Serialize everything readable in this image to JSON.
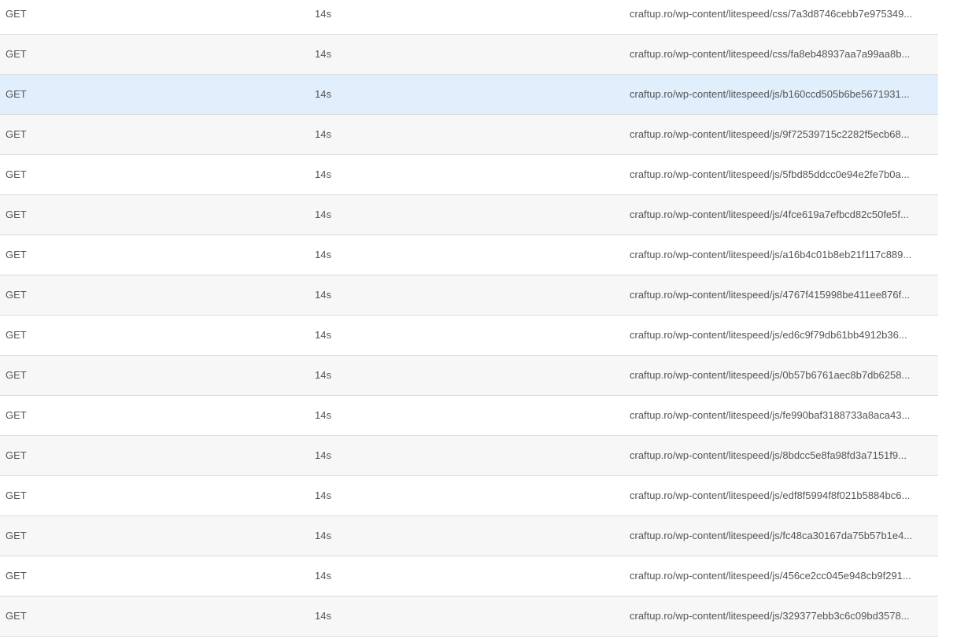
{
  "requests": [
    {
      "method": "GET",
      "time": "14s",
      "url": "craftup.ro/wp-content/litespeed/css/7a3d8746cebb7e975349..."
    },
    {
      "method": "GET",
      "time": "14s",
      "url": "craftup.ro/wp-content/litespeed/css/fa8eb48937aa7a99aa8b..."
    },
    {
      "method": "GET",
      "time": "14s",
      "url": "craftup.ro/wp-content/litespeed/js/b160ccd505b6be5671931..."
    },
    {
      "method": "GET",
      "time": "14s",
      "url": "craftup.ro/wp-content/litespeed/js/9f72539715c2282f5ecb68..."
    },
    {
      "method": "GET",
      "time": "14s",
      "url": "craftup.ro/wp-content/litespeed/js/5fbd85ddcc0e94e2fe7b0a..."
    },
    {
      "method": "GET",
      "time": "14s",
      "url": "craftup.ro/wp-content/litespeed/js/4fce619a7efbcd82c50fe5f..."
    },
    {
      "method": "GET",
      "time": "14s",
      "url": "craftup.ro/wp-content/litespeed/js/a16b4c01b8eb21f117c889..."
    },
    {
      "method": "GET",
      "time": "14s",
      "url": "craftup.ro/wp-content/litespeed/js/4767f415998be411ee876f..."
    },
    {
      "method": "GET",
      "time": "14s",
      "url": "craftup.ro/wp-content/litespeed/js/ed6c9f79db61bb4912b36..."
    },
    {
      "method": "GET",
      "time": "14s",
      "url": "craftup.ro/wp-content/litespeed/js/0b57b6761aec8b7db6258..."
    },
    {
      "method": "GET",
      "time": "14s",
      "url": "craftup.ro/wp-content/litespeed/js/fe990baf3188733a8aca43..."
    },
    {
      "method": "GET",
      "time": "14s",
      "url": "craftup.ro/wp-content/litespeed/js/8bdcc5e8fa98fd3a7151f9..."
    },
    {
      "method": "GET",
      "time": "14s",
      "url": "craftup.ro/wp-content/litespeed/js/edf8f5994f8f021b5884bc6..."
    },
    {
      "method": "GET",
      "time": "14s",
      "url": "craftup.ro/wp-content/litespeed/js/fc48ca30167da75b57b1e4..."
    },
    {
      "method": "GET",
      "time": "14s",
      "url": "craftup.ro/wp-content/litespeed/js/456ce2cc045e948cb9f291..."
    },
    {
      "method": "GET",
      "time": "14s",
      "url": "craftup.ro/wp-content/litespeed/js/329377ebb3c6c09bd3578..."
    }
  ],
  "selected_row_index": 2,
  "colors": {
    "row_background": "#ffffff",
    "row_striped_background": "#f7f7f7",
    "row_selected_background": "#e1eefb",
    "row_border": "#dcdcdc",
    "text": "#555555"
  }
}
